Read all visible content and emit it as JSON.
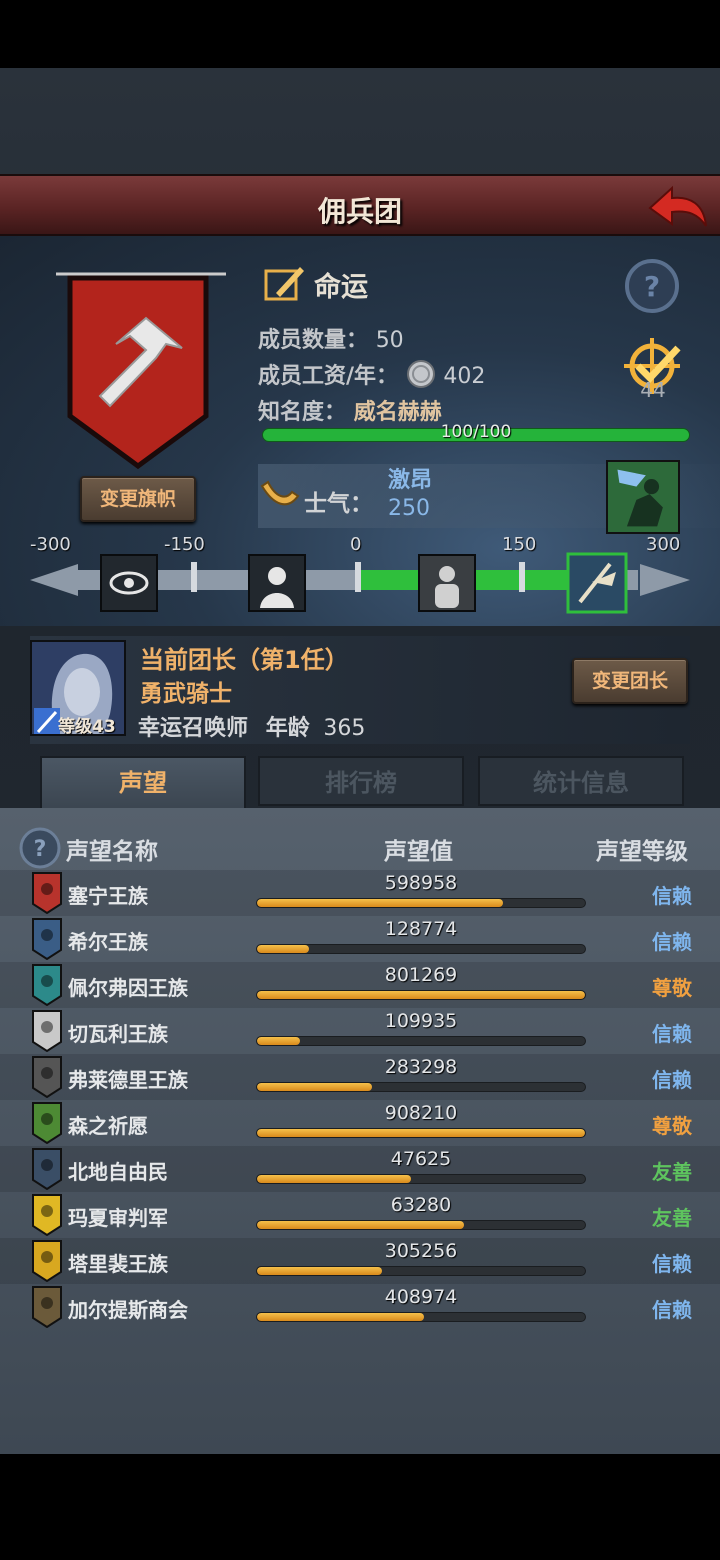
{
  "header": {
    "title": "佣兵团"
  },
  "info": {
    "change_flag_label": "变更旗帜",
    "fate_label": "命运",
    "members_label": "成员数量：",
    "members_value": "50",
    "wage_label": "成员工资/年：",
    "wage_value": "402",
    "fame_label": "知名度：",
    "fame_value": "威名赫赫",
    "fame_bar_text": "100/100",
    "fame_progress": 1.0,
    "target_count": "44",
    "morale_label": "士气：",
    "morale_state": "激昂",
    "morale_value": "250"
  },
  "morale_scale": {
    "ticks": [
      "-300",
      "-150",
      "0",
      "150",
      "300"
    ],
    "current": 250
  },
  "leader": {
    "title": "当前团长（第1任）",
    "class": "勇武骑士",
    "level_text": "等级43",
    "sub_class": "幸运召唤师",
    "age_label": "年龄",
    "age_value": "365",
    "change_leader_label": "变更团长"
  },
  "tabs": [
    {
      "label": "声望"
    },
    {
      "label": "排行榜"
    },
    {
      "label": "统计信息"
    }
  ],
  "reputation": {
    "col_name": "声望名称",
    "col_value": "声望值",
    "col_level": "声望等级",
    "rows": [
      {
        "name": "塞宁王族",
        "value": "598958",
        "progress": 0.75,
        "level": "信赖",
        "level_color": "#7fb6ee",
        "crest_color": "#b8332c"
      },
      {
        "name": "希尔王族",
        "value": "128774",
        "progress": 0.16,
        "level": "信赖",
        "level_color": "#7fb6ee",
        "crest_color": "#3a5d86"
      },
      {
        "name": "佩尔弗因王族",
        "value": "801269",
        "progress": 1.0,
        "level": "尊敬",
        "level_color": "#f0a040",
        "crest_color": "#2c8a8a"
      },
      {
        "name": "切瓦利王族",
        "value": "109935",
        "progress": 0.13,
        "level": "信赖",
        "level_color": "#7fb6ee",
        "crest_color": "#c9c9c9"
      },
      {
        "name": "弗莱德里王族",
        "value": "283298",
        "progress": 0.35,
        "level": "信赖",
        "level_color": "#7fb6ee",
        "crest_color": "#555555"
      },
      {
        "name": "森之祈愿",
        "value": "908210",
        "progress": 1.0,
        "level": "尊敬",
        "level_color": "#f0a040",
        "crest_color": "#4d8a34"
      },
      {
        "name": "北地自由民",
        "value": "47625",
        "progress": 0.47,
        "level": "友善",
        "level_color": "#5ec45e",
        "crest_color": "#3a4e66"
      },
      {
        "name": "玛夏审判军",
        "value": "63280",
        "progress": 0.63,
        "level": "友善",
        "level_color": "#5ec45e",
        "crest_color": "#e0b824"
      },
      {
        "name": "塔里裴王族",
        "value": "305256",
        "progress": 0.38,
        "level": "信赖",
        "level_color": "#7fb6ee",
        "crest_color": "#d8a820"
      },
      {
        "name": "加尔提斯商会",
        "value": "408974",
        "progress": 0.51,
        "level": "信赖",
        "level_color": "#7fb6ee",
        "crest_color": "#6b5a3a"
      }
    ]
  }
}
